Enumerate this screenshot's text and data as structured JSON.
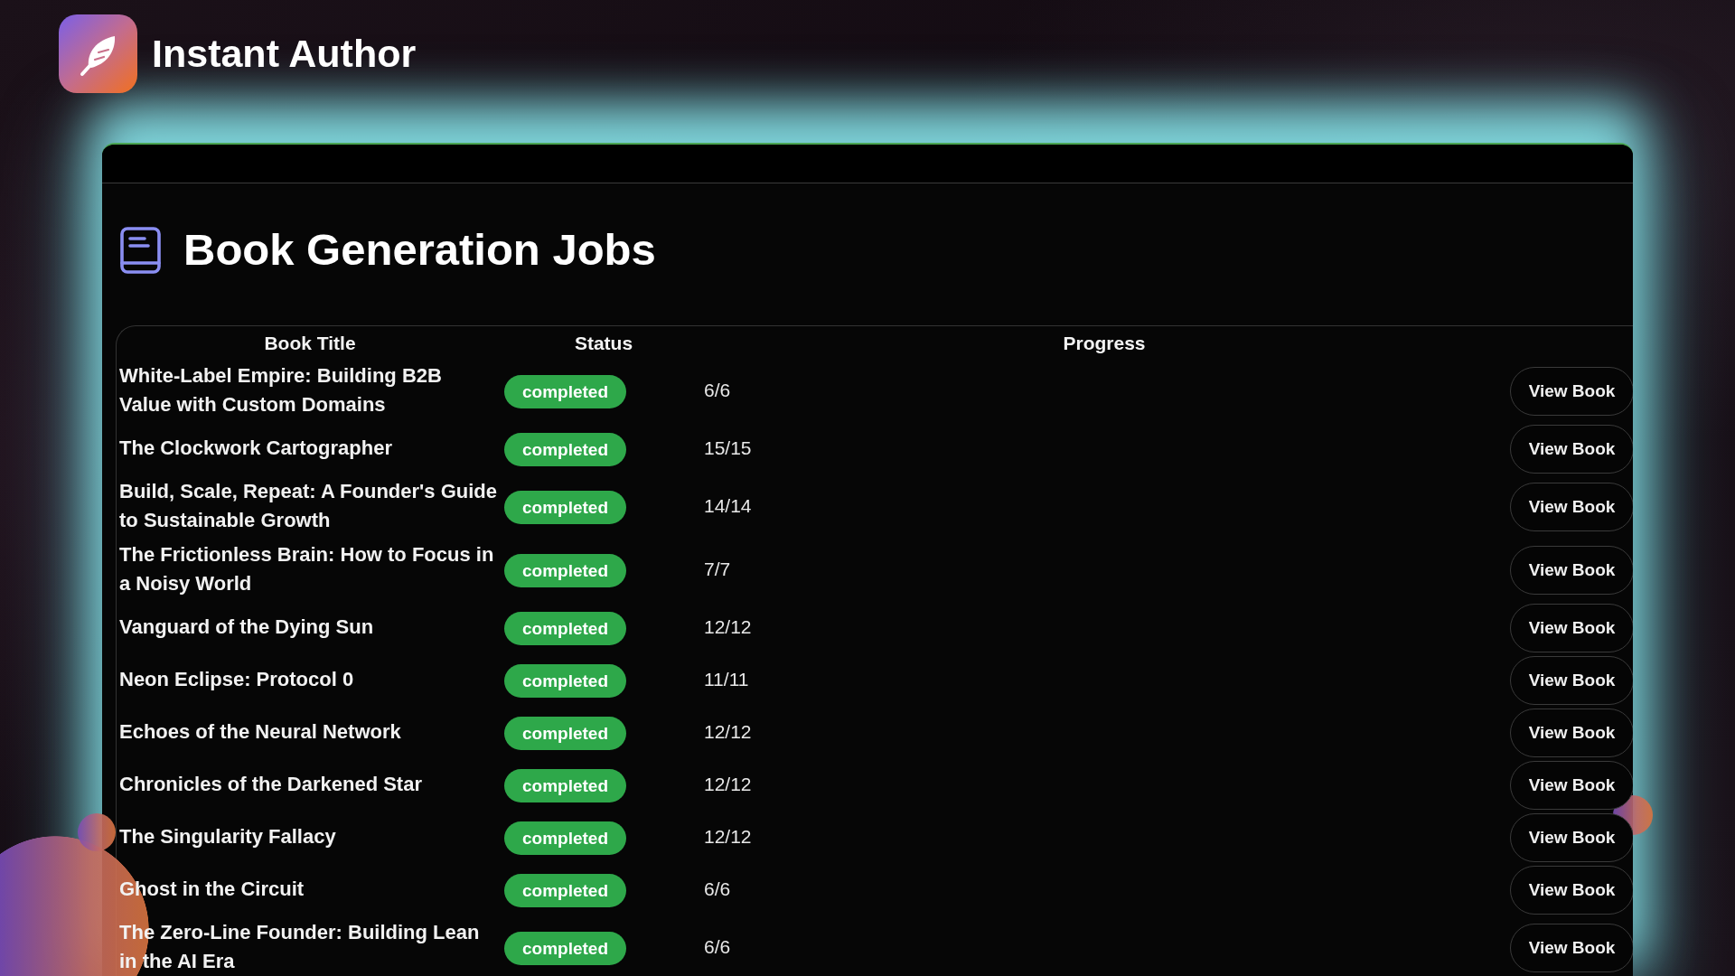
{
  "app": {
    "name": "Instant Author"
  },
  "page": {
    "title": "Book Generation Jobs"
  },
  "table": {
    "columns": [
      "Book Title",
      "Status",
      "Progress"
    ],
    "rows": [
      {
        "title": "White-Label Empire: Building B2B Value with Custom Domains",
        "status": "completed",
        "progress": "6/6",
        "action": "View Book"
      },
      {
        "title": "The Clockwork Cartographer",
        "status": "completed",
        "progress": "15/15",
        "action": "View Book"
      },
      {
        "title": "Build, Scale, Repeat: A Founder's Guide to Sustainable Growth",
        "status": "completed",
        "progress": "14/14",
        "action": "View Book"
      },
      {
        "title": "The Frictionless Brain: How to Focus in a Noisy World",
        "status": "completed",
        "progress": "7/7",
        "action": "View Book"
      },
      {
        "title": "Vanguard of the Dying Sun",
        "status": "completed",
        "progress": "12/12",
        "action": "View Book"
      },
      {
        "title": "Neon Eclipse: Protocol 0",
        "status": "completed",
        "progress": "11/11",
        "action": "View Book"
      },
      {
        "title": "Echoes of the Neural Network",
        "status": "completed",
        "progress": "12/12",
        "action": "View Book"
      },
      {
        "title": "Chronicles of the Darkened Star",
        "status": "completed",
        "progress": "12/12",
        "action": "View Book"
      },
      {
        "title": "The Singularity Fallacy",
        "status": "completed",
        "progress": "12/12",
        "action": "View Book"
      },
      {
        "title": "Ghost in the Circuit",
        "status": "completed",
        "progress": "6/6",
        "action": "View Book"
      },
      {
        "title": "The Zero-Line Founder: Building Lean in the AI Era",
        "status": "completed",
        "progress": "6/6",
        "action": "View Book"
      }
    ]
  }
}
